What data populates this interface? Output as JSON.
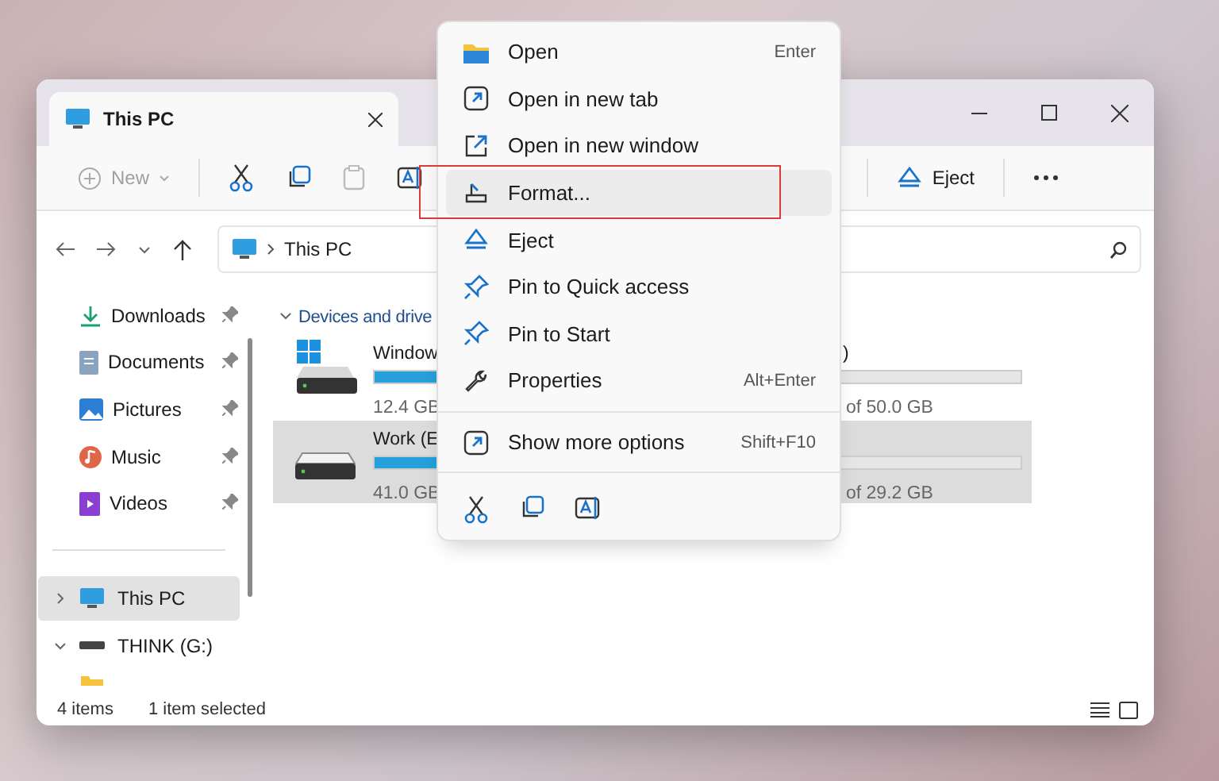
{
  "window": {
    "tab_title": "This PC",
    "address": "This PC"
  },
  "toolbar": {
    "new_label": "New",
    "new_disabled": true,
    "paste_disabled": true,
    "eject_label": "Eject"
  },
  "sidebar": {
    "quick_access": [
      {
        "label": "Downloads",
        "pinned": true
      },
      {
        "label": "Documents",
        "pinned": true
      },
      {
        "label": "Pictures",
        "pinned": true
      },
      {
        "label": "Music",
        "pinned": true
      },
      {
        "label": "Videos",
        "pinned": true
      }
    ],
    "tree": [
      {
        "label": "This PC",
        "expanded": false,
        "selected": true
      },
      {
        "label": "THINK (G:)",
        "expanded": true,
        "selected": false
      }
    ]
  },
  "content": {
    "section": "Devices and drive",
    "section_expanded": true,
    "drives": [
      {
        "name": "Window",
        "free": "12.4 GB",
        "name_tail": ")",
        "total": "of 50.0 GB",
        "level": 0.7,
        "selected": false,
        "windows_logo": true
      },
      {
        "name": "Work (E",
        "free": "41.0 GB",
        "total": "of 29.2 GB",
        "level": 0.45,
        "selected": true,
        "windows_logo": false
      }
    ]
  },
  "status_bar": {
    "count": "4 items",
    "selection": "1 item selected"
  },
  "context_menu": {
    "items": [
      {
        "kind": "item",
        "label": "Open",
        "shortcut": "Enter",
        "selected": false
      },
      {
        "kind": "item",
        "label": "Open in new tab",
        "selected": false
      },
      {
        "kind": "item",
        "label": "Open in new window",
        "selected": false
      },
      {
        "kind": "item",
        "label": "Format...",
        "selected": true,
        "annotated": true
      },
      {
        "kind": "item",
        "label": "Eject",
        "selected": false
      },
      {
        "kind": "item",
        "label": "Pin to Quick access",
        "selected": false
      },
      {
        "kind": "item",
        "label": "Pin to Start",
        "selected": false
      },
      {
        "kind": "item",
        "label": "Properties",
        "shortcut": "Alt+Enter",
        "selected": false
      },
      {
        "kind": "separator"
      },
      {
        "kind": "item",
        "label": "Show more options",
        "shortcut": "Shift+F10",
        "selected": false
      },
      {
        "kind": "separator"
      },
      {
        "kind": "actions"
      }
    ]
  }
}
